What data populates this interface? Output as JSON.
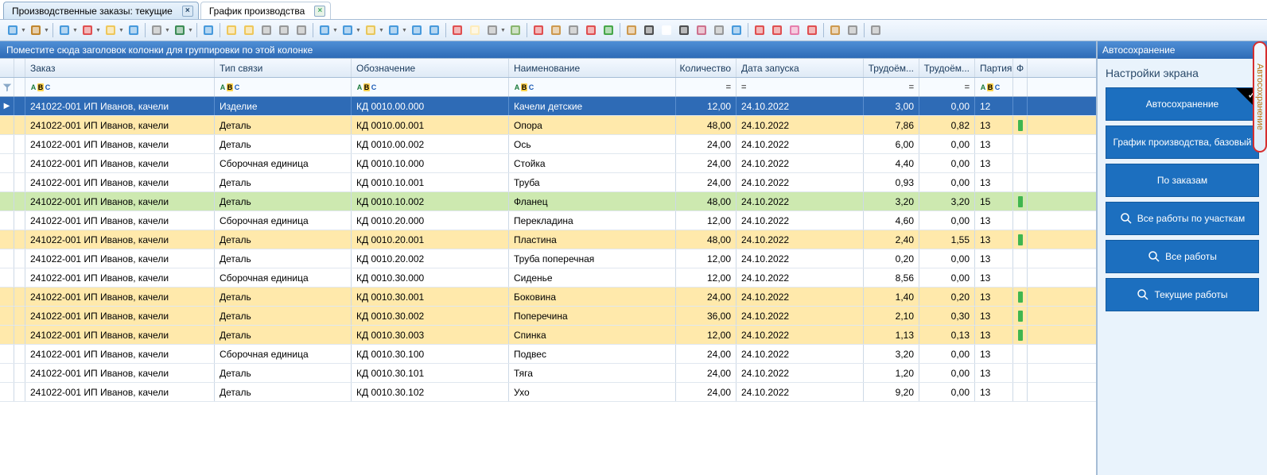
{
  "tabs": [
    {
      "label": "Производственные заказы: текущие",
      "active": false
    },
    {
      "label": "График производства",
      "active": true
    }
  ],
  "toolbar_icons": [
    "new-doc",
    "dd",
    "print",
    "dd",
    "sep",
    "save",
    "dd",
    "delete",
    "dd",
    "duplicate",
    "dd",
    "refresh",
    "sep",
    "wrench",
    "dd",
    "excel",
    "dd",
    "sep",
    "route",
    "sep",
    "stack1",
    "stack2",
    "stack3",
    "stack4",
    "machine",
    "sep",
    "series-num",
    "dd",
    "tree-expand",
    "dd",
    "note",
    "dd",
    "list",
    "dd",
    "filter-col",
    "funnel",
    "sep",
    "colors",
    "props",
    "scheme",
    "dd",
    "tag",
    "sep",
    "calendar",
    "clock",
    "find",
    "calendar2",
    "checkmark",
    "sep",
    "package",
    "barcode",
    "doc",
    "binoc",
    "people",
    "tool",
    "struct",
    "sep",
    "grid",
    "pencil",
    "badge",
    "up",
    "sep",
    "window",
    "link",
    "sep",
    "menu"
  ],
  "group_panel": "Поместите сюда заголовок колонки для группировки по этой колонке",
  "columns": {
    "order": "Заказ",
    "type": "Тип связи",
    "desig": "Обозначение",
    "name": "Наименование",
    "qty": "Количество",
    "date": "Дата запуска",
    "trud1": "Трудоём...",
    "trud2": "Трудоём...",
    "batch": "Партия",
    "flag_col": "Ф"
  },
  "filter_ops": {
    "text": "abc",
    "num": "=",
    "text2": "abc"
  },
  "rows": [
    {
      "sel": true,
      "order": "241022-001 ИП Иванов, качели",
      "type": "Изделие",
      "desig": "КД 0010.00.000",
      "name": "Качели детские",
      "qty": "12,00",
      "date": "24.10.2022",
      "t1": "3,00",
      "t2": "0,00",
      "batch": "12",
      "flag": false,
      "cls": "selected",
      "arrow": true
    },
    {
      "order": "241022-001 ИП Иванов, качели",
      "type": "Деталь",
      "desig": "КД 0010.00.001",
      "name": "Опора",
      "qty": "48,00",
      "date": "24.10.2022",
      "t1": "7,86",
      "t2": "0,82",
      "batch": "13",
      "flag": true,
      "cls": "orange"
    },
    {
      "order": "241022-001 ИП Иванов, качели",
      "type": "Деталь",
      "desig": "КД 0010.00.002",
      "name": "Ось",
      "qty": "24,00",
      "date": "24.10.2022",
      "t1": "6,00",
      "t2": "0,00",
      "batch": "13",
      "flag": false,
      "cls": ""
    },
    {
      "order": "241022-001 ИП Иванов, качели",
      "type": "Сборочная единица",
      "desig": "КД 0010.10.000",
      "name": "Стойка",
      "qty": "24,00",
      "date": "24.10.2022",
      "t1": "4,40",
      "t2": "0,00",
      "batch": "13",
      "flag": false,
      "cls": ""
    },
    {
      "order": "241022-001 ИП Иванов, качели",
      "type": "Деталь",
      "desig": "КД 0010.10.001",
      "name": "Труба",
      "qty": "24,00",
      "date": "24.10.2022",
      "t1": "0,93",
      "t2": "0,00",
      "batch": "13",
      "flag": false,
      "cls": ""
    },
    {
      "order": "241022-001 ИП Иванов, качели",
      "type": "Деталь",
      "desig": "КД 0010.10.002",
      "name": "Фланец",
      "qty": "48,00",
      "date": "24.10.2022",
      "t1": "3,20",
      "t2": "3,20",
      "batch": "15",
      "flag": true,
      "cls": "green"
    },
    {
      "order": "241022-001 ИП Иванов, качели",
      "type": "Сборочная единица",
      "desig": "КД 0010.20.000",
      "name": "Перекладина",
      "qty": "12,00",
      "date": "24.10.2022",
      "t1": "4,60",
      "t2": "0,00",
      "batch": "13",
      "flag": false,
      "cls": ""
    },
    {
      "order": "241022-001 ИП Иванов, качели",
      "type": "Деталь",
      "desig": "КД 0010.20.001",
      "name": "Пластина",
      "qty": "48,00",
      "date": "24.10.2022",
      "t1": "2,40",
      "t2": "1,55",
      "batch": "13",
      "flag": true,
      "cls": "orange"
    },
    {
      "order": "241022-001 ИП Иванов, качели",
      "type": "Деталь",
      "desig": "КД 0010.20.002",
      "name": "Труба поперечная",
      "qty": "12,00",
      "date": "24.10.2022",
      "t1": "0,20",
      "t2": "0,00",
      "batch": "13",
      "flag": false,
      "cls": ""
    },
    {
      "order": "241022-001 ИП Иванов, качели",
      "type": "Сборочная единица",
      "desig": "КД 0010.30.000",
      "name": "Сиденье",
      "qty": "12,00",
      "date": "24.10.2022",
      "t1": "8,56",
      "t2": "0,00",
      "batch": "13",
      "flag": false,
      "cls": ""
    },
    {
      "order": "241022-001 ИП Иванов, качели",
      "type": "Деталь",
      "desig": "КД 0010.30.001",
      "name": "Боковина",
      "qty": "24,00",
      "date": "24.10.2022",
      "t1": "1,40",
      "t2": "0,20",
      "batch": "13",
      "flag": true,
      "cls": "orange"
    },
    {
      "order": "241022-001 ИП Иванов, качели",
      "type": "Деталь",
      "desig": "КД 0010.30.002",
      "name": "Поперечина",
      "qty": "36,00",
      "date": "24.10.2022",
      "t1": "2,10",
      "t2": "0,30",
      "batch": "13",
      "flag": true,
      "cls": "orange"
    },
    {
      "order": "241022-001 ИП Иванов, качели",
      "type": "Деталь",
      "desig": "КД 0010.30.003",
      "name": "Спинка",
      "qty": "12,00",
      "date": "24.10.2022",
      "t1": "1,13",
      "t2": "0,13",
      "batch": "13",
      "flag": true,
      "cls": "orange"
    },
    {
      "order": "241022-001 ИП Иванов, качели",
      "type": "Сборочная единица",
      "desig": "КД 0010.30.100",
      "name": "Подвес",
      "qty": "24,00",
      "date": "24.10.2022",
      "t1": "3,20",
      "t2": "0,00",
      "batch": "13",
      "flag": false,
      "cls": ""
    },
    {
      "order": "241022-001 ИП Иванов, качели",
      "type": "Деталь",
      "desig": "КД 0010.30.101",
      "name": "Тяга",
      "qty": "24,00",
      "date": "24.10.2022",
      "t1": "1,20",
      "t2": "0,00",
      "batch": "13",
      "flag": false,
      "cls": ""
    },
    {
      "order": "241022-001 ИП Иванов, качели",
      "type": "Деталь",
      "desig": "КД 0010.30.102",
      "name": "Ухо",
      "qty": "24,00",
      "date": "24.10.2022",
      "t1": "9,20",
      "t2": "0,00",
      "batch": "13",
      "flag": false,
      "cls": ""
    }
  ],
  "side": {
    "title": "Автосохранение",
    "sub": "Настройки экрана",
    "buttons": [
      {
        "label": "Автосохранение",
        "checked": true,
        "mag": false
      },
      {
        "label": "График производства, базовый",
        "checked": false,
        "mag": false
      },
      {
        "label": "По заказам",
        "checked": false,
        "mag": false
      },
      {
        "label": "Все работы по участкам",
        "checked": false,
        "mag": true
      },
      {
        "label": "Все работы",
        "checked": false,
        "mag": true
      },
      {
        "label": "Текущие работы",
        "checked": false,
        "mag": true
      }
    ]
  },
  "collapsed_tab": "Автосохранение"
}
